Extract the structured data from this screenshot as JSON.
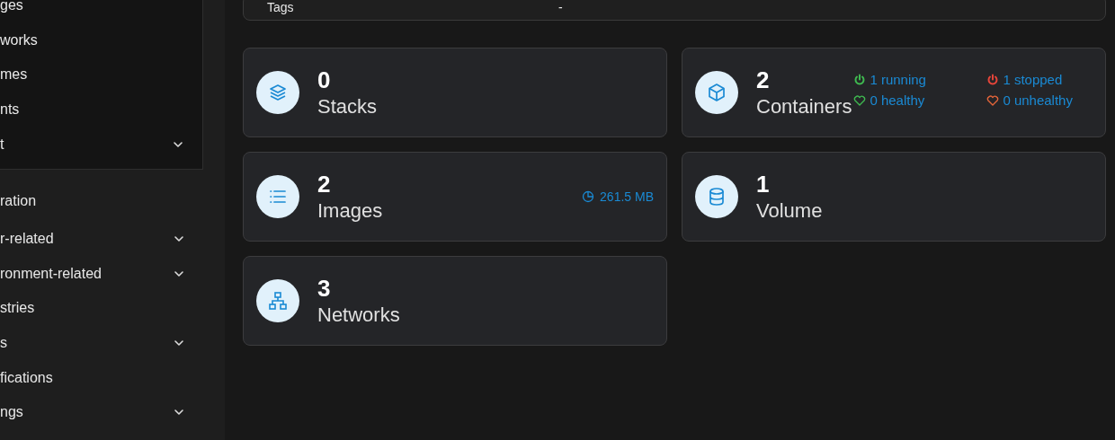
{
  "sidebar": {
    "submenu": [
      {
        "label": "ges",
        "expandable": false
      },
      {
        "label": "works",
        "expandable": false
      },
      {
        "label": "mes",
        "expandable": false
      },
      {
        "label": "nts",
        "expandable": false
      },
      {
        "label": "t",
        "expandable": true
      }
    ],
    "section_title": "ration",
    "items": [
      {
        "label": "r-related",
        "expandable": true
      },
      {
        "label": "ronment-related",
        "expandable": true
      },
      {
        "label": "stries",
        "expandable": false
      },
      {
        "label": "s",
        "expandable": true
      },
      {
        "label": "fications",
        "expandable": false
      },
      {
        "label": "ngs",
        "expandable": true
      }
    ]
  },
  "info_card": {
    "rows": [
      {
        "label": "Tags",
        "value": "-"
      }
    ]
  },
  "tiles": [
    {
      "kind": "stacks",
      "count": "0",
      "label": "Stacks"
    },
    {
      "kind": "containers",
      "count": "2",
      "label": "Containers",
      "stats": [
        {
          "kind": "power",
          "color": "#3fb950",
          "text": "1 running"
        },
        {
          "kind": "power",
          "color": "#e5453a",
          "text": "1 stopped"
        },
        {
          "kind": "heart",
          "color": "#3fb950",
          "text": "0 healthy"
        },
        {
          "kind": "heart",
          "color": "#e5653a",
          "text": "0 unhealthy"
        }
      ]
    },
    {
      "kind": "images",
      "count": "2",
      "label": "Images",
      "size": "261.5 MB"
    },
    {
      "kind": "volumes",
      "count": "1",
      "label": "Volume"
    },
    {
      "kind": "networks",
      "count": "3",
      "label": "Networks"
    }
  ]
}
